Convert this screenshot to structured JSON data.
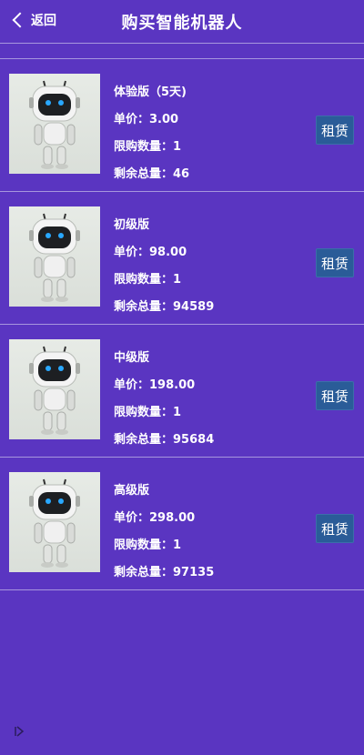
{
  "header": {
    "back_label": "返回",
    "title": "购买智能机器人"
  },
  "products": [
    {
      "name": "体验版（5天)",
      "price_label": "单价：",
      "price": "3.00",
      "limit_label": "限购数量：",
      "limit": "1",
      "remaining_label": "剩余总量：",
      "remaining": "46",
      "button": "租赁"
    },
    {
      "name": "初级版",
      "price_label": "单价：",
      "price": "98.00",
      "limit_label": "限购数量：",
      "limit": "1",
      "remaining_label": "剩余总量：",
      "remaining": "94589",
      "button": "租赁"
    },
    {
      "name": "中级版",
      "price_label": "单价：",
      "price": "198.00",
      "limit_label": "限购数量：",
      "limit": "1",
      "remaining_label": "剩余总量：",
      "remaining": "95684",
      "button": "租赁"
    },
    {
      "name": "高级版",
      "price_label": "单价：",
      "price": "298.00",
      "limit_label": "限购数量：",
      "limit": "1",
      "remaining_label": "剩余总量：",
      "remaining": "97135",
      "button": "租赁"
    }
  ],
  "icons": {
    "back": "chevron-left-icon",
    "product_image": "robot-icon",
    "bottom": "play-outline-icon"
  },
  "colors": {
    "background": "#5a35c1",
    "divider": "#a796de",
    "button": "#2a5c98"
  }
}
